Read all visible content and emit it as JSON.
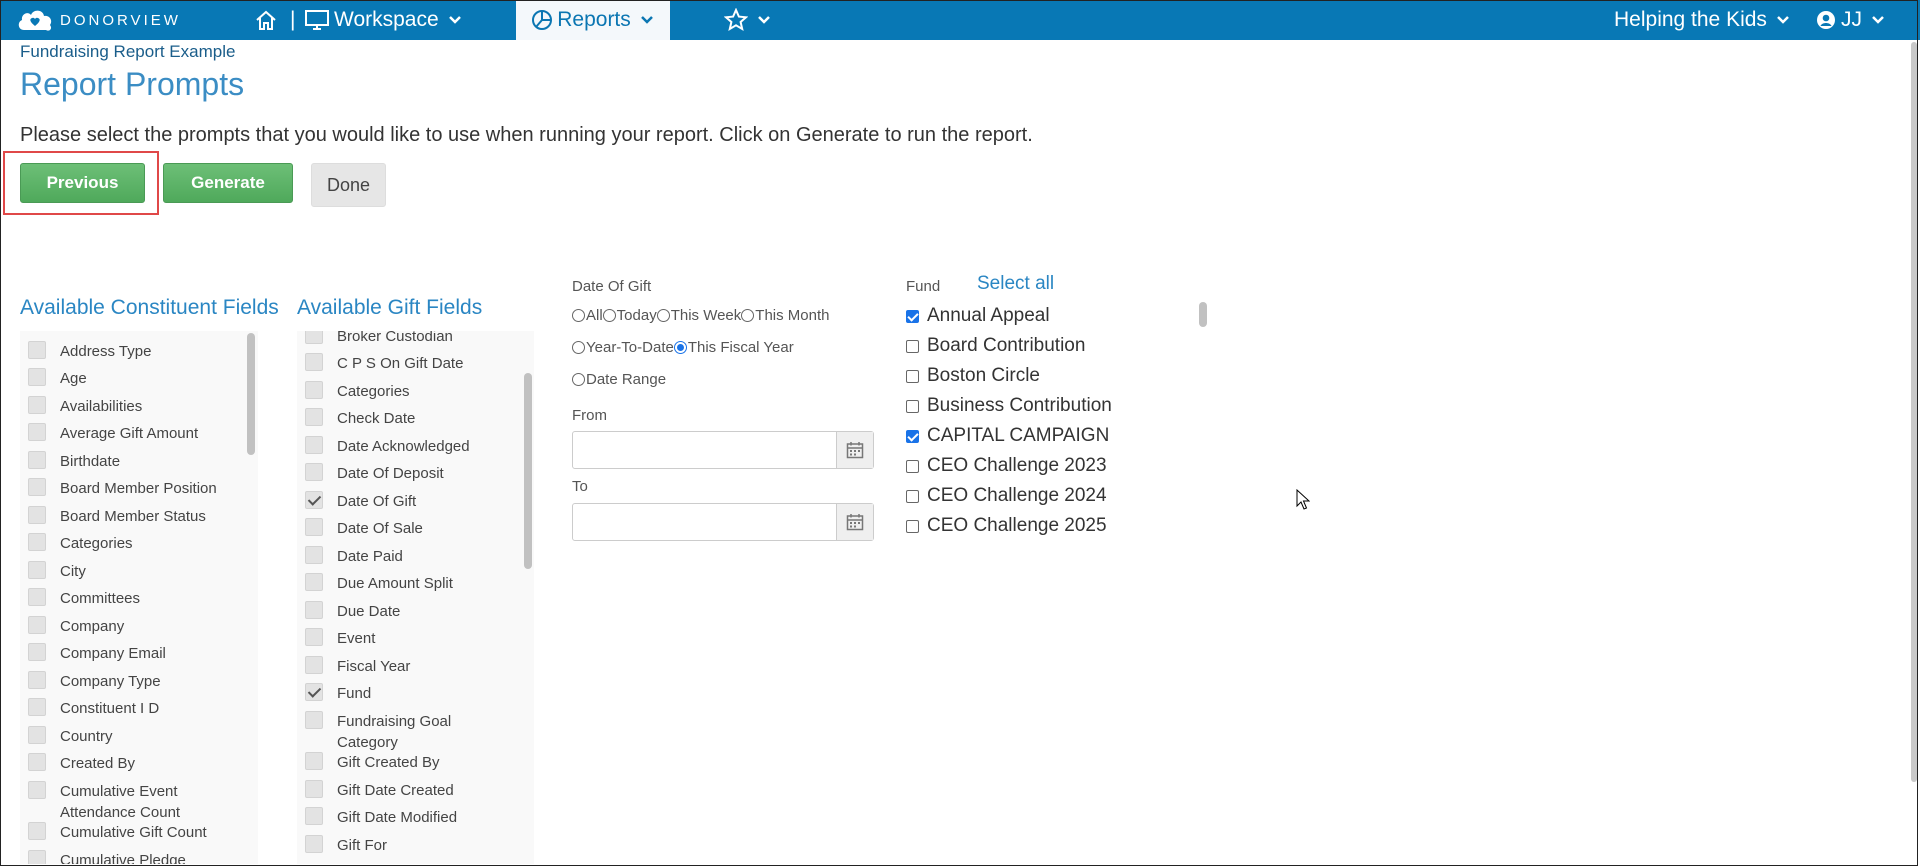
{
  "nav": {
    "logo_text": "DONORVIEW",
    "workspace": "Workspace",
    "reports": "Reports",
    "org": "Helping the Kids",
    "user": "JJ",
    "separator": "|"
  },
  "header": {
    "breadcrumb": "Fundraising Report Example",
    "title": "Report Prompts",
    "instructions": "Please select the prompts that you would like to use when running your report. Click on Generate to run the report."
  },
  "buttons": {
    "previous": "Previous",
    "generate": "Generate",
    "done": "Done"
  },
  "constituent": {
    "heading": "Available Constituent Fields",
    "items": [
      {
        "label": "Address Type",
        "checked": false
      },
      {
        "label": "Age",
        "checked": false
      },
      {
        "label": "Availabilities",
        "checked": false
      },
      {
        "label": "Average Gift Amount",
        "checked": false
      },
      {
        "label": "Birthdate",
        "checked": false
      },
      {
        "label": "Board Member Position",
        "checked": false
      },
      {
        "label": "Board Member Status",
        "checked": false
      },
      {
        "label": "Categories",
        "checked": false
      },
      {
        "label": "City",
        "checked": false
      },
      {
        "label": "Committees",
        "checked": false
      },
      {
        "label": "Company",
        "checked": false
      },
      {
        "label": "Company Email",
        "checked": false
      },
      {
        "label": "Company Type",
        "checked": false
      },
      {
        "label": "Constituent I D",
        "checked": false
      },
      {
        "label": "Country",
        "checked": false
      },
      {
        "label": "Created By",
        "checked": false
      },
      {
        "label": "Cumulative Event Attendance Count",
        "checked": false
      },
      {
        "label": "Cumulative Gift Count",
        "checked": false
      },
      {
        "label": "Cumulative Pledge Write",
        "checked": false
      }
    ]
  },
  "gift": {
    "heading": "Available Gift Fields",
    "items": [
      {
        "label": "Broker Custodian",
        "checked": false
      },
      {
        "label": "C P S On Gift Date",
        "checked": false
      },
      {
        "label": "Categories",
        "checked": false
      },
      {
        "label": "Check Date",
        "checked": false
      },
      {
        "label": "Date Acknowledged",
        "checked": false
      },
      {
        "label": "Date Of Deposit",
        "checked": false
      },
      {
        "label": "Date Of Gift",
        "checked": true
      },
      {
        "label": "Date Of Sale",
        "checked": false
      },
      {
        "label": "Date Paid",
        "checked": false
      },
      {
        "label": "Due Amount Split",
        "checked": false
      },
      {
        "label": "Due Date",
        "checked": false
      },
      {
        "label": "Event",
        "checked": false
      },
      {
        "label": "Fiscal Year",
        "checked": false
      },
      {
        "label": "Fund",
        "checked": true
      },
      {
        "label": "Fundraising Goal Category",
        "checked": false
      },
      {
        "label": "Gift Created By",
        "checked": false
      },
      {
        "label": "Gift Date Created",
        "checked": false
      },
      {
        "label": "Gift Date Modified",
        "checked": false
      },
      {
        "label": "Gift For",
        "checked": false
      }
    ]
  },
  "date_of_gift": {
    "label": "Date Of Gift",
    "options": [
      "All",
      "Today",
      "This Week",
      "This Month",
      "Year-To-Date",
      "This Fiscal Year",
      "Date Range"
    ],
    "selected": "This Fiscal Year",
    "from_label": "From",
    "to_label": "To",
    "from_value": "",
    "to_value": ""
  },
  "fund": {
    "label": "Fund",
    "select_all": "Select all",
    "items": [
      {
        "label": "Annual Appeal",
        "checked": true
      },
      {
        "label": "Board Contribution",
        "checked": false
      },
      {
        "label": "Boston Circle",
        "checked": false
      },
      {
        "label": "Business Contribution",
        "checked": false
      },
      {
        "label": "CAPITAL CAMPAIGN",
        "checked": true
      },
      {
        "label": "CEO Challenge 2023",
        "checked": false
      },
      {
        "label": "CEO Challenge 2024",
        "checked": false
      },
      {
        "label": "CEO Challenge 2025",
        "checked": false
      }
    ]
  },
  "colors": {
    "nav_bg": "#0878b5",
    "accent": "#2a86c3",
    "green": "#5cb466"
  }
}
